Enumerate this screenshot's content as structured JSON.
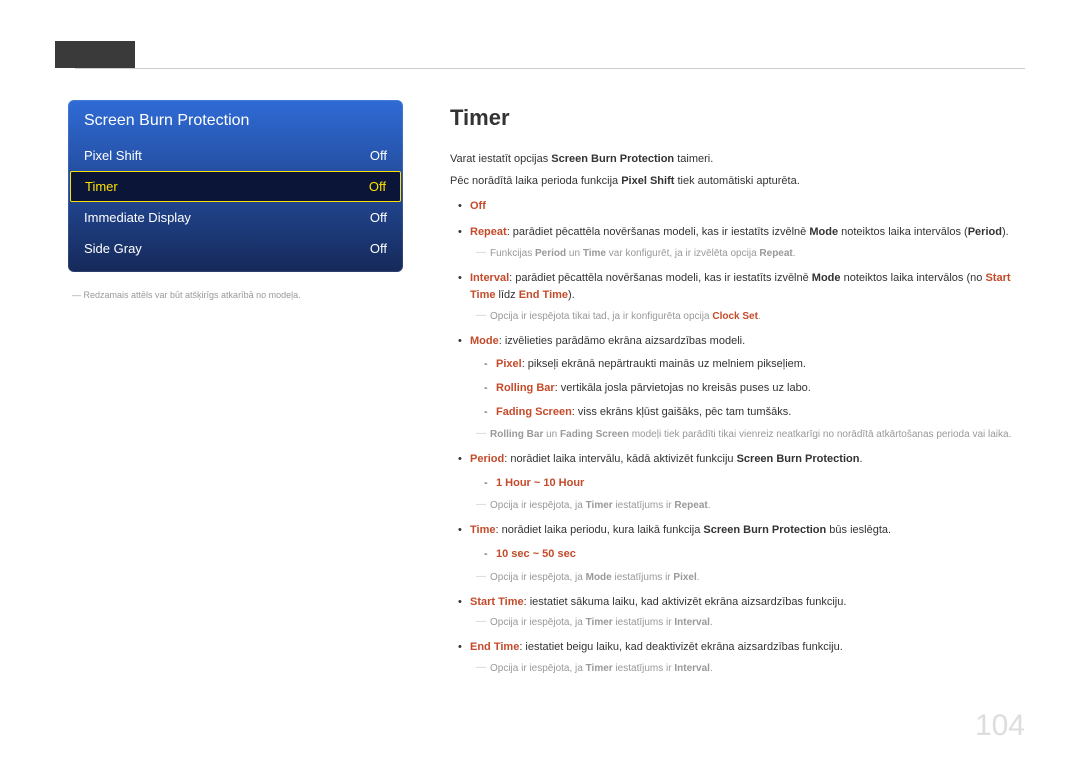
{
  "page_number": "104",
  "osd": {
    "title": "Screen Burn Protection",
    "rows": [
      {
        "label": "Pixel Shift",
        "value": "Off",
        "selected": false
      },
      {
        "label": "Timer",
        "value": "Off",
        "selected": true
      },
      {
        "label": "Immediate Display",
        "value": "Off",
        "selected": false
      },
      {
        "label": "Side Gray",
        "value": "Off",
        "selected": false
      }
    ],
    "footnote": "― Redzamais attēls var būt atšķirīgs atkarībā no modeļa."
  },
  "section": {
    "title": "Timer",
    "intro1_a": "Varat iestatīt opcijas ",
    "intro1_b": "Screen Burn Protection",
    "intro1_c": " taimeri.",
    "intro2_a": "Pēc norādītā laika perioda funkcija ",
    "intro2_b": "Pixel Shift",
    "intro2_c": " tiek automātiski apturēta.",
    "off": "Off",
    "repeat_hi": "Repeat",
    "repeat_txt": ": parādiet pēcattēla novēršanas modeli, kas ir iestatīts izvēlnē ",
    "repeat_mode": "Mode",
    "repeat_txt2": " noteiktos laika intervālos (",
    "repeat_period": "Period",
    "repeat_txt3": ").",
    "repeat_note_a": "Funkcijas ",
    "repeat_note_b": "Period",
    "repeat_note_c": " un ",
    "repeat_note_d": "Time",
    "repeat_note_e": " var konfigurēt, ja ir izvēlēta opcija ",
    "repeat_note_f": "Repeat",
    "interval_hi": "Interval",
    "interval_txt": ": parādiet pēcattēla novēršanas modeli, kas ir iestatīts izvēlnē ",
    "interval_mode": "Mode",
    "interval_txt2": " noteiktos laika intervālos (no ",
    "interval_start": "Start Time",
    "interval_txt3": " līdz ",
    "interval_end": "End Time",
    "interval_txt4": ").",
    "interval_note_a": "Opcija ir iespējota tikai tad, ja ir konfigurēta opcija ",
    "interval_note_b": "Clock Set",
    "mode_hi": "Mode",
    "mode_txt": ": izvēlieties parādāmo ekrāna aizsardzības modeli.",
    "pixel_hi": "Pixel",
    "pixel_txt": ": pikseļi ekrānā nepārtraukti mainās uz melniem pikseļiem.",
    "rolling_hi": "Rolling Bar",
    "rolling_txt": ": vertikāla josla pārvietojas no kreisās puses uz labo.",
    "fading_hi": "Fading Screen",
    "fading_txt": ": viss ekrāns kļūst gaišāks, pēc tam tumšāks.",
    "mode_note_a": "Rolling Bar",
    "mode_note_b": " un ",
    "mode_note_c": "Fading Screen",
    "mode_note_d": " modeļi tiek parādīti tikai vienreiz neatkarīgi no norādītā atkārtošanas perioda vai laika.",
    "period_hi": "Period",
    "period_txt": ": norādiet laika intervālu, kādā aktivizēt funkciju ",
    "period_sbp": "Screen Burn Protection",
    "period_range": "1 Hour ~ 10 Hour",
    "period_note_a": "Opcija ir iespējota, ja ",
    "period_note_b": "Timer",
    "period_note_c": " iestatījums ir ",
    "period_note_d": "Repeat",
    "time_hi": "Time",
    "time_txt": ": norādiet laika periodu, kura laikā funkcija ",
    "time_sbp": "Screen Burn Protection",
    "time_txt2": " būs ieslēgta.",
    "time_range": "10 sec ~ 50 sec",
    "time_note_a": "Opcija ir iespējota, ja ",
    "time_note_b": "Mode",
    "time_note_c": " iestatījums ir ",
    "time_note_d": "Pixel",
    "start_hi": "Start Time",
    "start_txt": ": iestatiet sākuma laiku, kad aktivizēt ekrāna aizsardzības funkciju.",
    "start_note_a": "Opcija ir iespējota, ja ",
    "start_note_b": "Timer",
    "start_note_c": " iestatījums ir ",
    "start_note_d": "Interval",
    "end_hi": "End Time",
    "end_txt": ": iestatiet beigu laiku, kad deaktivizēt ekrāna aizsardzības funkciju.",
    "end_note_a": "Opcija ir iespējota, ja ",
    "end_note_b": "Timer",
    "end_note_c": " iestatījums ir ",
    "end_note_d": "Interval"
  }
}
